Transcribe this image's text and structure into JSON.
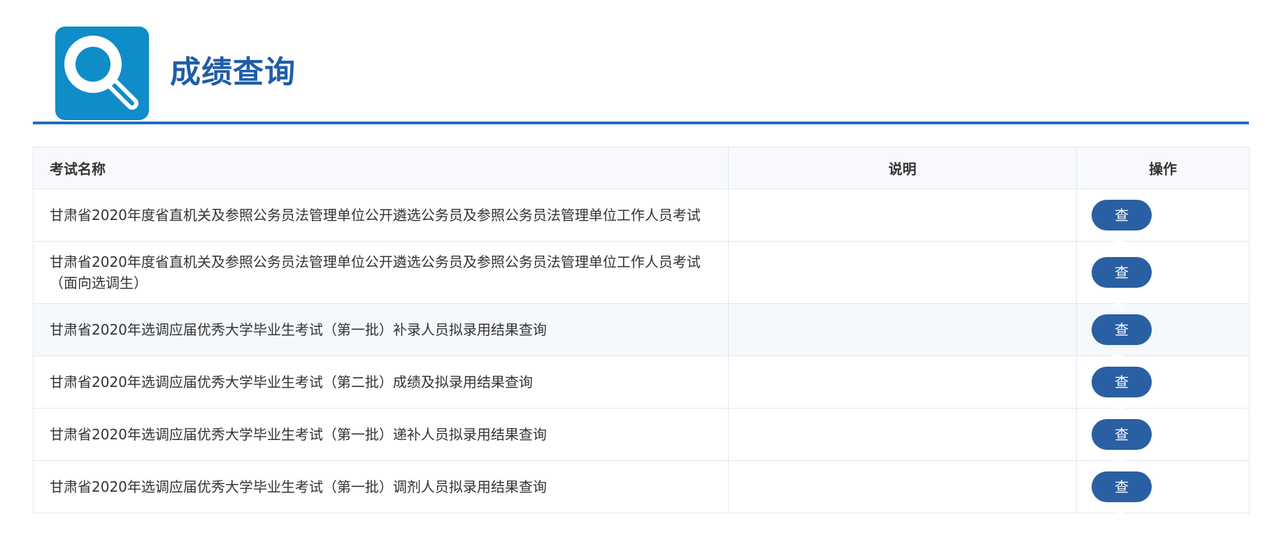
{
  "header": {
    "title": "成绩查询",
    "logo_icon": "search-icon",
    "accent_color": "#1f6fc0",
    "logo_bg_color": "#0f8dc8"
  },
  "table": {
    "columns": [
      "考试名称",
      "说明",
      "操作"
    ],
    "rows": [
      {
        "name": "甘肃省2020年度省直机关及参照公务员法管理单位公开遴选公务员及参照公务员法管理单位工作人员考试",
        "desc": "",
        "action": "查 询"
      },
      {
        "name": "甘肃省2020年度省直机关及参照公务员法管理单位公开遴选公务员及参照公务员法管理单位工作人员考试（面向选调生）",
        "desc": "",
        "action": "查 询"
      },
      {
        "name": "甘肃省2020年选调应届优秀大学毕业生考试（第一批）补录人员拟录用结果查询",
        "desc": "",
        "action": "查 询"
      },
      {
        "name": "甘肃省2020年选调应届优秀大学毕业生考试（第二批）成绩及拟录用结果查询",
        "desc": "",
        "action": "查 询"
      },
      {
        "name": "甘肃省2020年选调应届优秀大学毕业生考试（第一批）递补人员拟录用结果查询",
        "desc": "",
        "action": "查 询"
      },
      {
        "name": "甘肃省2020年选调应届优秀大学毕业生考试（第一批）调剂人员拟录用结果查询",
        "desc": "",
        "action": "查 询"
      }
    ],
    "button_color": "#2a5fa3"
  }
}
